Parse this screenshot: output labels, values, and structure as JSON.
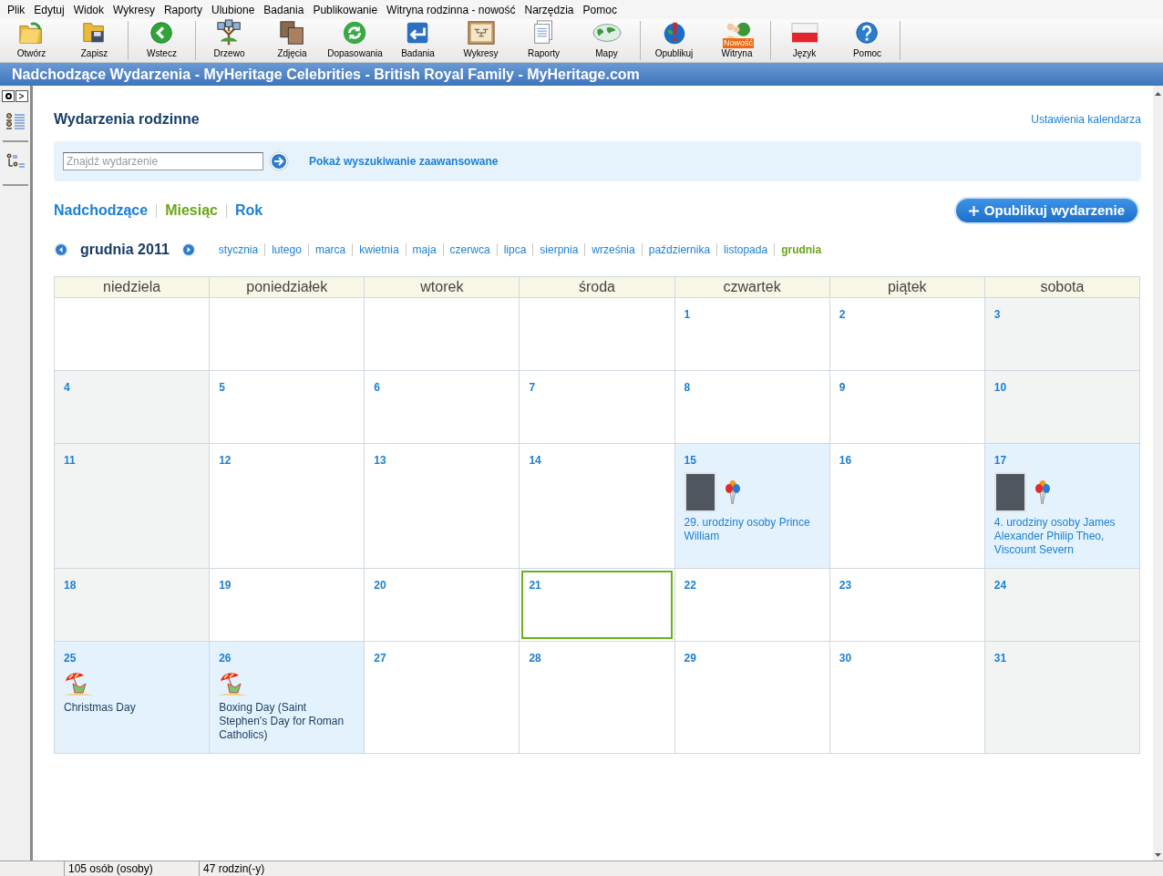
{
  "menu_bar": [
    "Plik",
    "Edytuj",
    "Widok",
    "Wykresy",
    "Raporty",
    "Ulubione",
    "Badania",
    "Publikowanie",
    "Witryna rodzinna - nowość",
    "Narzędzia",
    "Pomoc"
  ],
  "toolbar": [
    {
      "label": "Otwórz"
    },
    {
      "label": "Zapisz"
    },
    {
      "label": "Wstecz"
    },
    {
      "label": "Drzewo"
    },
    {
      "label": "Zdjęcia"
    },
    {
      "label": "Dopasowania"
    },
    {
      "label": "Badania"
    },
    {
      "label": "Wykresy"
    },
    {
      "label": "Raporty"
    },
    {
      "label": "Mapy"
    },
    {
      "label": "Opublikuj"
    },
    {
      "label": "Witryna",
      "badge": "Nowość"
    },
    {
      "label": "Język"
    },
    {
      "label": "Pomoc"
    }
  ],
  "window": {
    "title": "Nadchodzące Wydarzenia - MyHeritage Celebrities - British Royal Family - MyHeritage.com"
  },
  "page": {
    "heading": "Wydarzenia rodzinne",
    "settings_link": "Ustawienia kalendarza",
    "search": {
      "placeholder": "Znajdź wydarzenie",
      "advanced_link": "Pokaż wyszukiwanie zaawansowane"
    },
    "views": [
      {
        "label": "Nadchodzące",
        "selected": false
      },
      {
        "label": "Miesiąc",
        "selected": true
      },
      {
        "label": "Rok",
        "selected": false
      }
    ],
    "publish_button": "Opublikuj wydarzenie",
    "current_month": "grudnia 2011",
    "months": [
      {
        "label": "stycznia",
        "selected": false
      },
      {
        "label": "lutego",
        "selected": false
      },
      {
        "label": "marca",
        "selected": false
      },
      {
        "label": "kwietnia",
        "selected": false
      },
      {
        "label": "maja",
        "selected": false
      },
      {
        "label": "czerwca",
        "selected": false
      },
      {
        "label": "lipca",
        "selected": false
      },
      {
        "label": "sierpnia",
        "selected": false
      },
      {
        "label": "września",
        "selected": false
      },
      {
        "label": "października",
        "selected": false
      },
      {
        "label": "listopada",
        "selected": false
      },
      {
        "label": "grudnia",
        "selected": true
      }
    ],
    "calendar": {
      "weekdays": [
        "niedziela",
        "poniedziałek",
        "wtorek",
        "środa",
        "czwartek",
        "piątek",
        "sobota"
      ],
      "weeks": [
        [
          {
            "kind": "blank"
          },
          {
            "kind": "blank"
          },
          {
            "kind": "blank"
          },
          {
            "kind": "blank"
          },
          {
            "day": "1",
            "today": false
          },
          {
            "day": "2",
            "today": false
          },
          {
            "day": "3",
            "today": false
          }
        ],
        [
          {
            "day": "4",
            "today": false
          },
          {
            "day": "5",
            "today": false
          },
          {
            "day": "6",
            "today": false
          },
          {
            "day": "7",
            "today": false
          },
          {
            "day": "8",
            "today": false
          },
          {
            "day": "9",
            "today": false
          },
          {
            "day": "10",
            "today": false
          }
        ],
        [
          {
            "day": "11",
            "today": false
          },
          {
            "day": "12",
            "today": false
          },
          {
            "day": "13",
            "today": false
          },
          {
            "day": "14",
            "today": false
          },
          {
            "day": "15",
            "today": false,
            "events": [
              {
                "kind": "birthday",
                "text": "29. urodziny osoby Prince William"
              }
            ]
          },
          {
            "day": "16",
            "today": false
          },
          {
            "day": "17",
            "today": false,
            "events": [
              {
                "kind": "birthday",
                "text": "4. urodziny osoby James Alexander Philip Theo, Viscount Severn"
              }
            ]
          }
        ],
        [
          {
            "day": "18",
            "today": false
          },
          {
            "day": "19",
            "today": false
          },
          {
            "day": "20",
            "today": false
          },
          {
            "day": "21",
            "today": true
          },
          {
            "day": "22",
            "today": false
          },
          {
            "day": "23",
            "today": false
          },
          {
            "day": "24",
            "today": false
          }
        ],
        [
          {
            "day": "25",
            "today": false,
            "events": [
              {
                "kind": "holiday",
                "text": "Christmas Day"
              }
            ]
          },
          {
            "day": "26",
            "today": false,
            "events": [
              {
                "kind": "holiday",
                "text": "Boxing Day (Saint Stephen's Day for Roman Catholics)"
              }
            ]
          },
          {
            "day": "27",
            "today": false
          },
          {
            "day": "28",
            "today": false
          },
          {
            "day": "29",
            "today": false
          },
          {
            "day": "30",
            "today": false
          },
          {
            "day": "31",
            "today": false
          }
        ]
      ]
    }
  },
  "status_bar": [
    "105 osób (osoby)",
    "47 rodzin(-y)"
  ]
}
